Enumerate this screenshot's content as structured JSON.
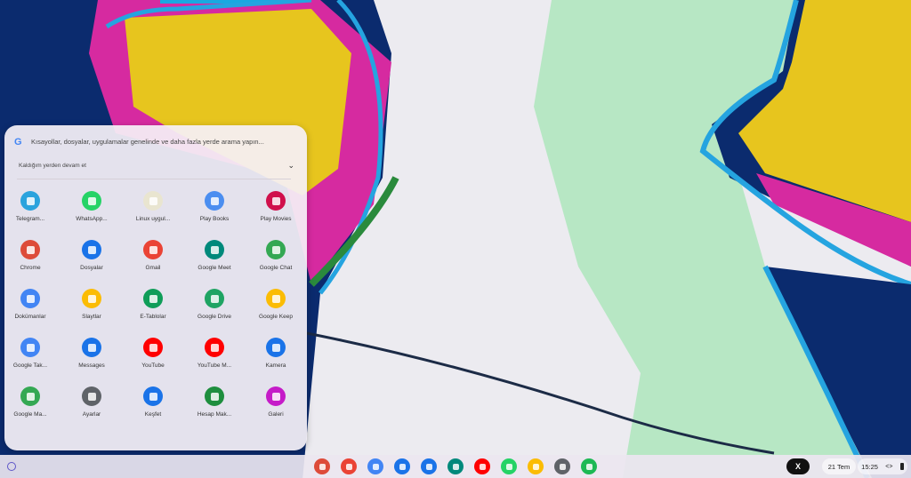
{
  "search": {
    "placeholder": "Kısayollar, dosyalar, uygulamalar genelinde ve daha fazla yerde arama yapın..."
  },
  "continue_label": "Kaldığım yerden devam et",
  "apps": [
    {
      "label": "Telegram...",
      "icon": "telegram-icon",
      "color": "#2aa3dd"
    },
    {
      "label": "WhatsApp...",
      "icon": "whatsapp-icon",
      "color": "#25d366"
    },
    {
      "label": "Linux uygul...",
      "icon": "linux-apps-folder-icon",
      "color": "#e9e5d0"
    },
    {
      "label": "Play Books",
      "icon": "play-books-icon",
      "color": "#4b8ef0"
    },
    {
      "label": "Play Movies",
      "icon": "play-movies-icon",
      "color": "#d0104c"
    },
    {
      "label": "Chrome",
      "icon": "chrome-icon",
      "color": "#dd4b39"
    },
    {
      "label": "Dosyalar",
      "icon": "files-icon",
      "color": "#1a73e8"
    },
    {
      "label": "Gmail",
      "icon": "gmail-icon",
      "color": "#ea4335"
    },
    {
      "label": "Google Meet",
      "icon": "google-meet-icon",
      "color": "#00897b"
    },
    {
      "label": "Google Chat",
      "icon": "google-chat-icon",
      "color": "#34a853"
    },
    {
      "label": "Dokümanlar",
      "icon": "docs-icon",
      "color": "#4285f4"
    },
    {
      "label": "Slaytlar",
      "icon": "slides-icon",
      "color": "#fbbc04"
    },
    {
      "label": "E-Tablolar",
      "icon": "sheets-icon",
      "color": "#0f9d58"
    },
    {
      "label": "Google Drive",
      "icon": "google-drive-icon",
      "color": "#1fa463"
    },
    {
      "label": "Google Keep",
      "icon": "google-keep-icon",
      "color": "#fbbc04"
    },
    {
      "label": "Google Tak...",
      "icon": "google-calendar-icon",
      "color": "#4285f4"
    },
    {
      "label": "Messages",
      "icon": "messages-icon",
      "color": "#1a73e8"
    },
    {
      "label": "YouTube",
      "icon": "youtube-icon",
      "color": "#ff0000"
    },
    {
      "label": "YouTube M...",
      "icon": "youtube-music-icon",
      "color": "#ff0000"
    },
    {
      "label": "Kamera",
      "icon": "camera-icon",
      "color": "#1a73e8"
    },
    {
      "label": "Google Ma...",
      "icon": "google-maps-icon",
      "color": "#34a853"
    },
    {
      "label": "Ayarlar",
      "icon": "settings-gear-icon",
      "color": "#5f6368"
    },
    {
      "label": "Keşfet",
      "icon": "explore-icon",
      "color": "#1a73e8"
    },
    {
      "label": "Hesap Mak...",
      "icon": "calculator-icon",
      "color": "#1e8e3e"
    },
    {
      "label": "Galeri",
      "icon": "gallery-icon",
      "color": "#c51bc8"
    }
  ],
  "shelf": {
    "pinned": [
      {
        "icon": "chrome-icon",
        "color": "#dd4b39"
      },
      {
        "icon": "gmail-icon",
        "color": "#ea4335"
      },
      {
        "icon": "docs-icon",
        "color": "#4285f4"
      },
      {
        "icon": "files-icon",
        "color": "#1a73e8"
      },
      {
        "icon": "messages-icon",
        "color": "#1a73e8"
      },
      {
        "icon": "google-meet-icon",
        "color": "#00897b"
      },
      {
        "icon": "youtube-icon",
        "color": "#ff0000"
      },
      {
        "icon": "whatsapp-icon",
        "color": "#25d366"
      },
      {
        "icon": "google-keep-icon",
        "color": "#fbbc04"
      },
      {
        "icon": "code-terminal-icon",
        "color": "#5f6368"
      },
      {
        "icon": "spotify-icon",
        "color": "#1db954"
      }
    ],
    "date": "21 Tem",
    "time": "15:25"
  }
}
